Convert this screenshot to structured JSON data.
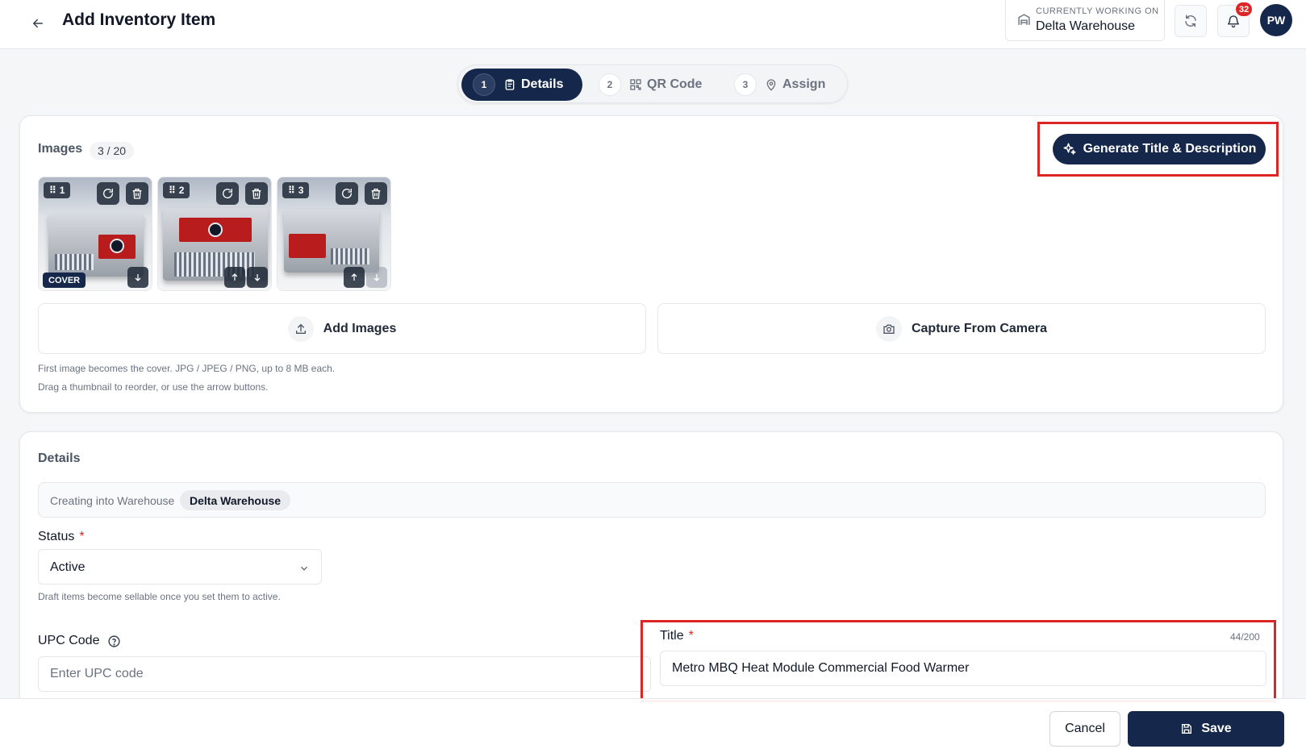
{
  "header": {
    "title": "Add Inventory Item",
    "working_caption": "CURRENTLY WORKING ON",
    "warehouse_name": "Delta Warehouse",
    "notification_count": "32",
    "avatar_initials": "PW"
  },
  "stepper": {
    "steps": [
      {
        "number": "1",
        "label": "Details",
        "icon": "clipboard-icon",
        "active": true
      },
      {
        "number": "2",
        "label": "QR Code",
        "icon": "qr-code-icon",
        "active": false
      },
      {
        "number": "3",
        "label": "Assign",
        "icon": "map-pin-icon",
        "active": false
      }
    ]
  },
  "images_section": {
    "title": "Images",
    "count": "3 / 20",
    "generate_label": "Generate Title & Description",
    "thumbnails": [
      {
        "index": "1",
        "cover": true
      },
      {
        "index": "2",
        "cover": false
      },
      {
        "index": "3",
        "cover": false
      }
    ],
    "cover_label": "COVER",
    "add_images_label": "Add Images",
    "capture_label": "Capture From Camera",
    "help_1": "First image becomes the cover. JPG / JPEG / PNG, up to 8 MB each.",
    "help_2": "Drag a thumbnail to reorder, or use the arrow buttons."
  },
  "details_section": {
    "title": "Details",
    "warehouse_prefix": "Creating into Warehouse",
    "warehouse_chip": "Delta Warehouse",
    "status_label": "Status",
    "status_value": "Active",
    "status_help": "Draft items become sellable once you set them to active.",
    "upc_label": "UPC Code",
    "upc_placeholder": "Enter UPC code",
    "title_label": "Title",
    "title_value": "Metro MBQ Heat Module Commercial Food Warmer",
    "title_count": "44/200",
    "required_mark": "*"
  },
  "footer": {
    "cancel_label": "Cancel",
    "save_label": "Save"
  },
  "colors": {
    "brand_navy": "#15284b",
    "highlight_red": "#dc2626"
  }
}
